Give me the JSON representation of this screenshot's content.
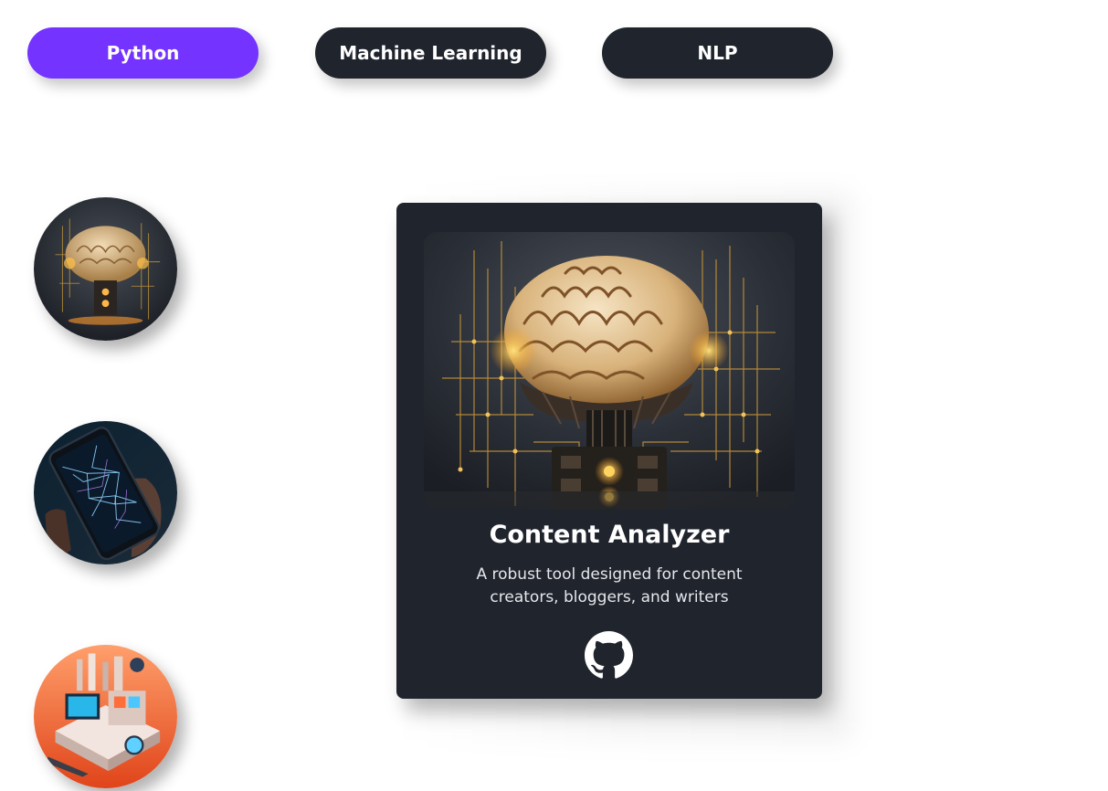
{
  "tabs": [
    {
      "label": "Python",
      "active": true
    },
    {
      "label": "Machine Learning",
      "active": false
    },
    {
      "label": "NLP",
      "active": false
    }
  ],
  "colors": {
    "accent": "#7433ff",
    "tab_inactive": "#20242d",
    "card_bg": "#20242d",
    "page_bg": "#ffffff"
  },
  "thumbnails": [
    {
      "icon": "brain-circuit-image"
    },
    {
      "icon": "smartphone-network-image"
    },
    {
      "icon": "isometric-workstation-image"
    }
  ],
  "card": {
    "image_icon": "brain-circuit-image",
    "title": "Content Analyzer",
    "description": "A robust tool designed for content creators, bloggers, and writers",
    "link_icon": "github-icon"
  }
}
